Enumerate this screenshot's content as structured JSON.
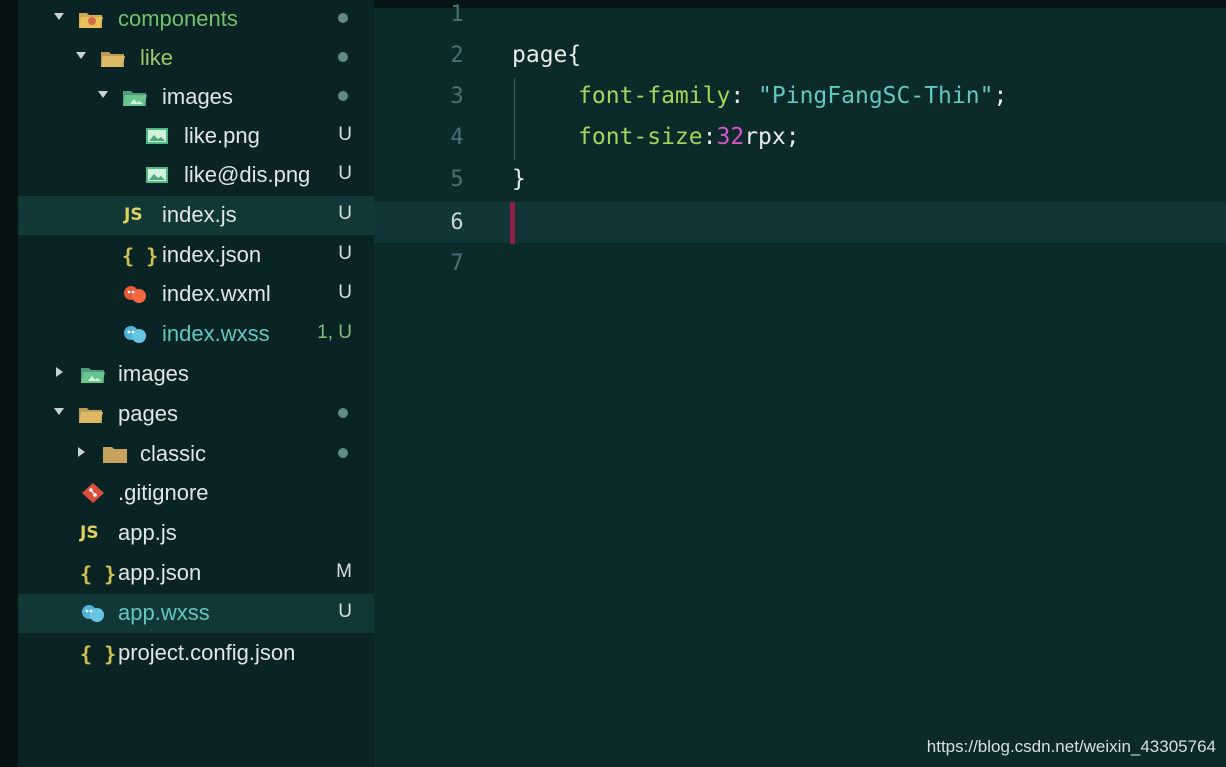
{
  "file_tree": {
    "items": [
      {
        "label": "components",
        "status": "•",
        "arrow": "down",
        "icon": "folder-open-icon"
      },
      {
        "label": "like",
        "status": "•",
        "arrow": "down",
        "icon": "folder-open-icon"
      },
      {
        "label": "images",
        "status": "•",
        "arrow": "down",
        "icon": "images-folder-icon"
      },
      {
        "label": "like.png",
        "status": "U",
        "icon": "image-icon"
      },
      {
        "label": "like@dis.png",
        "status": "U",
        "icon": "image-icon"
      },
      {
        "label": "index.js",
        "status": "U",
        "icon": "js-icon",
        "icon_text": "JS"
      },
      {
        "label": "index.json",
        "status": "U",
        "icon": "json-icon",
        "icon_text": "{ }"
      },
      {
        "label": "index.wxml",
        "status": "U",
        "icon": "wxml-icon"
      },
      {
        "label": "index.wxss",
        "status": "1, U",
        "icon": "wxss-icon"
      },
      {
        "label": "images",
        "arrow": "right",
        "icon": "images-folder-icon"
      },
      {
        "label": "pages",
        "status": "•",
        "arrow": "down",
        "icon": "folder-open-icon"
      },
      {
        "label": "classic",
        "status": "•",
        "arrow": "right",
        "icon": "folder-icon"
      },
      {
        "label": ".gitignore",
        "icon": "git-icon"
      },
      {
        "label": "app.js",
        "icon": "js-icon",
        "icon_text": "JS"
      },
      {
        "label": "app.json",
        "status": "M",
        "icon": "json-icon",
        "icon_text": "{ }"
      },
      {
        "label": "app.wxss",
        "status": "U",
        "icon": "wxss-icon"
      },
      {
        "label": "project.config.json",
        "icon": "json-icon",
        "icon_text": "{ }"
      }
    ]
  },
  "editor": {
    "line_numbers": [
      "1",
      "2",
      "3",
      "4",
      "5",
      "6",
      "7"
    ],
    "code": {
      "line2": "page{",
      "line3_prop": "font-family",
      "line3_colon": ":",
      "line3_value": "\"PingFangSC-Thin\"",
      "line3_end": ";",
      "line4_prop": "font-size",
      "line4_colon": ":",
      "line4_num": "32",
      "line4_unit": "rpx;",
      "line5": "}"
    }
  },
  "watermark": "https://blog.csdn.net/weixin_43305764",
  "colors": {
    "background": "#0d2a2b",
    "sidebar": "#0a2426",
    "selection": "#123737",
    "property": "#a6d35b",
    "string": "#61c8bf",
    "number": "#d454c9",
    "cursor": "#8c2248"
  }
}
